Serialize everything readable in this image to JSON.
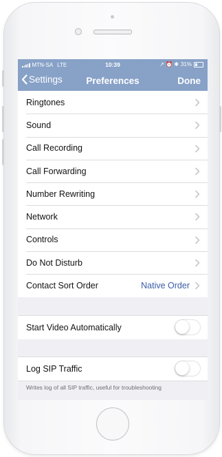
{
  "status_bar": {
    "carrier": "MTN-SA",
    "network": "LTE",
    "time": "10:39",
    "right_icons": "↗ ⏰ ✱",
    "battery": "31%"
  },
  "nav": {
    "back_label": "Settings",
    "title": "Preferences",
    "done_label": "Done"
  },
  "rows": [
    {
      "label": "Ringtones",
      "value": ""
    },
    {
      "label": "Sound",
      "value": ""
    },
    {
      "label": "Call Recording",
      "value": ""
    },
    {
      "label": "Call Forwarding",
      "value": ""
    },
    {
      "label": "Number Rewriting",
      "value": ""
    },
    {
      "label": "Network",
      "value": ""
    },
    {
      "label": "Controls",
      "value": ""
    },
    {
      "label": "Do Not Disturb",
      "value": ""
    },
    {
      "label": "Contact Sort Order",
      "value": "Native Order"
    }
  ],
  "video": {
    "label": "Start Video Automatically",
    "on": false
  },
  "sip": {
    "label": "Log SIP Traffic",
    "on": false,
    "note": "Writes log of all SIP traffic, useful for troubleshooting"
  },
  "colors": {
    "accent": "#87a1c7",
    "value_text": "#3b5ba5",
    "background": "#efeff4"
  },
  "icons": {
    "back": "chevron-left-icon",
    "disclosure": "chevron-right-icon"
  }
}
